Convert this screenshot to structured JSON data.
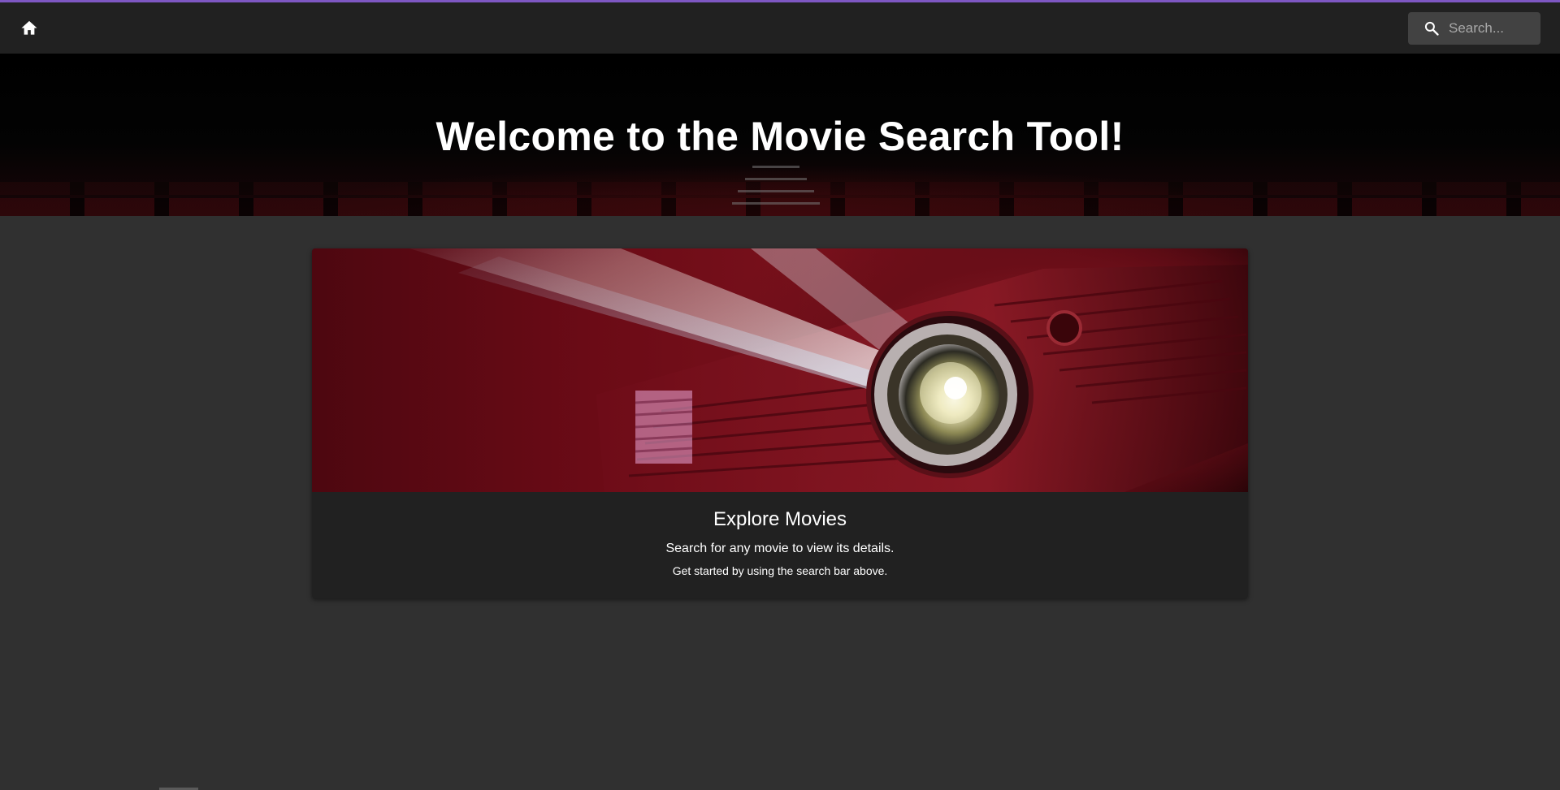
{
  "appbar": {
    "home_icon": "home-icon",
    "search": {
      "icon": "search-icon",
      "placeholder": "Search...",
      "value": ""
    },
    "accent_color": "#7e57c2"
  },
  "hero": {
    "title": "Welcome to the Movie Search Tool!"
  },
  "card": {
    "image": "movie-projector-image",
    "title": "Explore Movies",
    "text_primary": "Search for any movie to view its details.",
    "text_secondary": "Get started by using the search bar above."
  },
  "colors": {
    "background": "#303030",
    "surface": "#212121",
    "search_field": "#424242"
  }
}
